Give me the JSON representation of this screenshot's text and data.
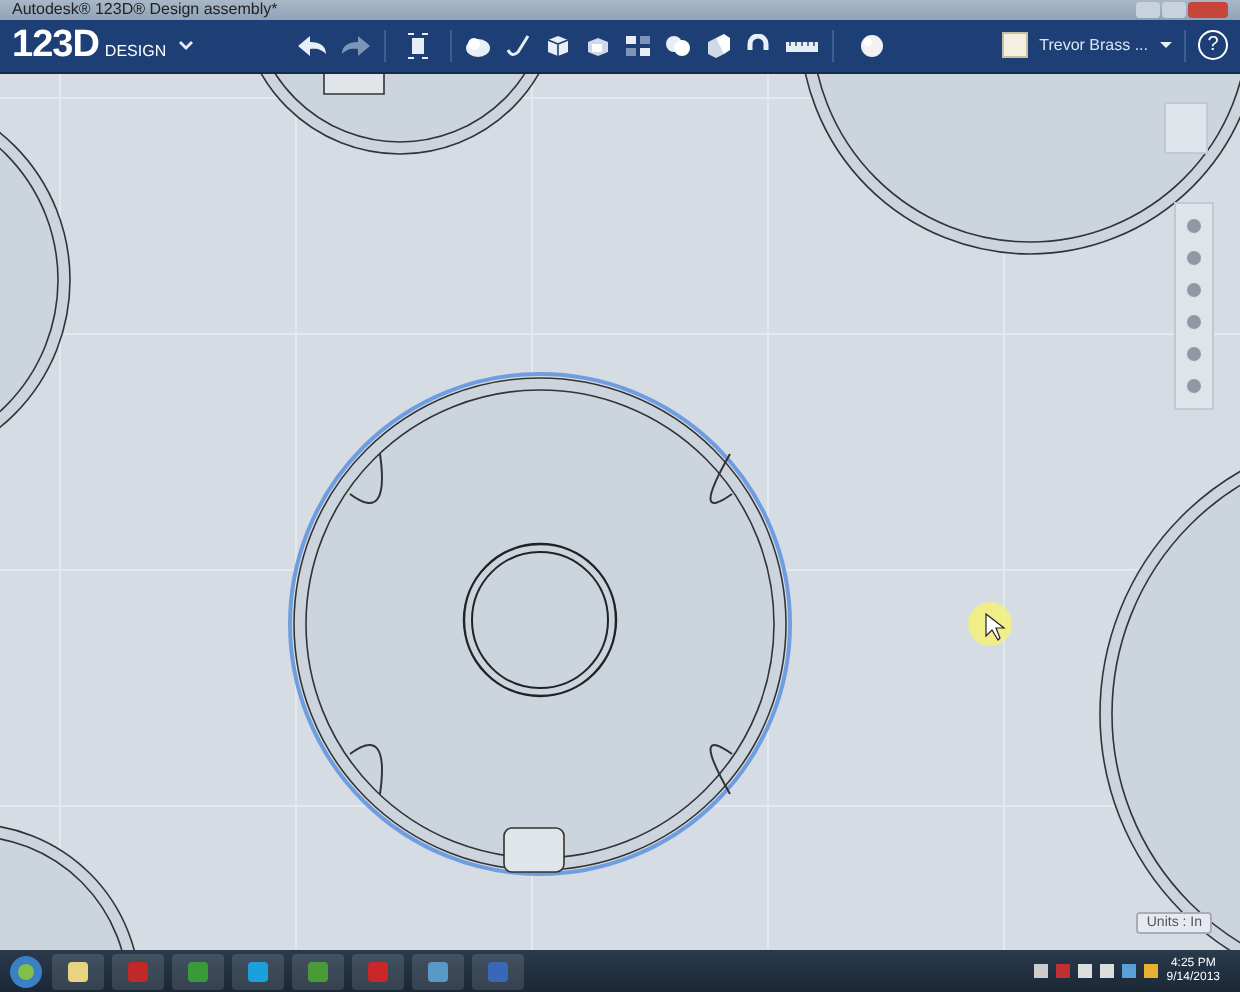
{
  "window": {
    "title": "Autodesk® 123D® Design assembly*"
  },
  "toolbar": {
    "logo": "123D",
    "logo_sub": "DESIGN",
    "user": "Trevor Brass ...",
    "help": "?"
  },
  "canvas": {
    "units": "Units : In"
  },
  "taskbar": {
    "time": "4:25 PM",
    "date": "9/14/2013"
  }
}
